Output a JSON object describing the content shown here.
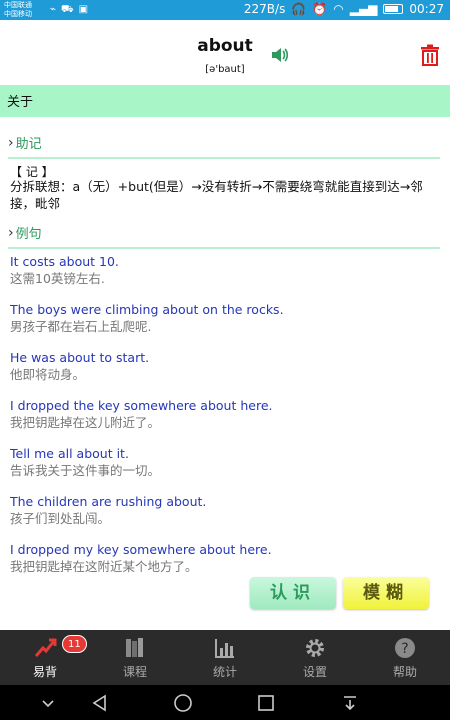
{
  "status_bar": {
    "carrier1": "中国联通",
    "carrier2": "中国移动",
    "speed": "227B/s",
    "time": "00:27"
  },
  "header": {
    "word": "about",
    "phonetic": "[ə'baut]",
    "meaning": "关于"
  },
  "sections": {
    "memo_heading": "助记",
    "memo_title": "【 记 】",
    "memo_text": "分拆联想：a（无）+but(但是）→没有转折→不需要绕弯就能直接到达→邻接，毗邻",
    "examples_heading": "例句"
  },
  "examples": [
    {
      "en": "It costs about 10.",
      "zh": "这需10英镑左右."
    },
    {
      "en": "The boys were climbing about on the rocks.",
      "zh": "男孩子都在岩石上乱爬呢."
    },
    {
      "en": "He was about to start.",
      "zh": "他即将动身。"
    },
    {
      "en": "I dropped the key somewhere about here.",
      "zh": "我把钥匙掉在这儿附近了。"
    },
    {
      "en": "Tell me all about it.",
      "zh": "告诉我关于这件事的一切。"
    },
    {
      "en": "The children are rushing about.",
      "zh": "孩子们到处乱闯。"
    },
    {
      "en": "I dropped my key somewhere about here.",
      "zh": "我把钥匙掉在这附近某个地方了。"
    }
  ],
  "buttons": {
    "know": "认识",
    "fuzzy": "模糊"
  },
  "tabs": [
    {
      "label": "易背",
      "icon": "quick-recite-icon",
      "badge": "11",
      "active": true
    },
    {
      "label": "课程",
      "icon": "books-icon",
      "active": false
    },
    {
      "label": "统计",
      "icon": "chart-icon",
      "active": false
    },
    {
      "label": "设置",
      "icon": "gear-icon",
      "active": false
    },
    {
      "label": "帮助",
      "icon": "help-icon",
      "active": false
    }
  ],
  "colors": {
    "status_bar": "#1f9bd8",
    "meaning_bar": "#a8f5c8",
    "section_heading": "#2c9a5c",
    "example_en": "#2536b8",
    "delete": "#e01b1b"
  }
}
